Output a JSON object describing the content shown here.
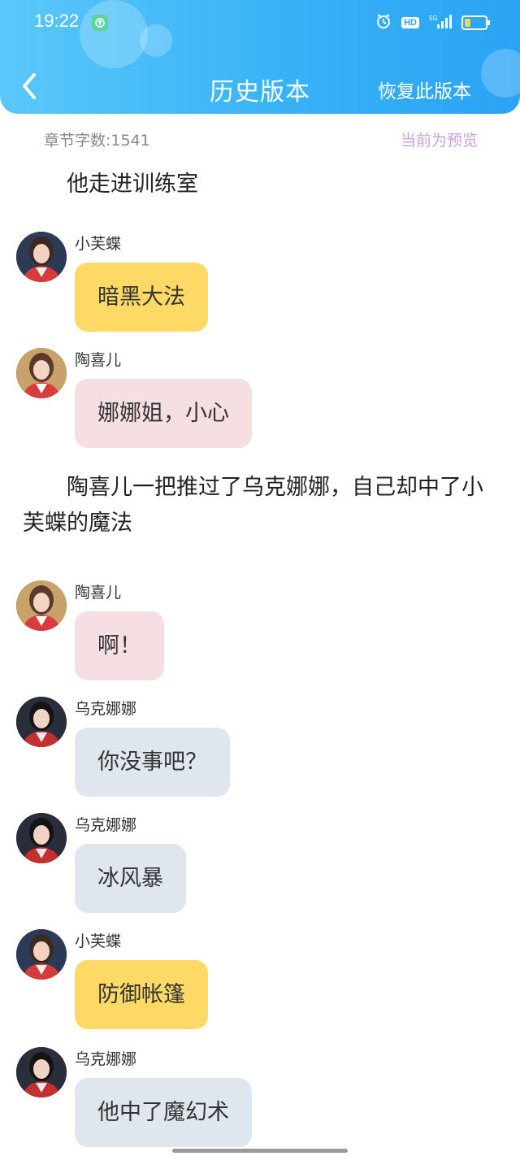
{
  "status_bar": {
    "time": "19:22",
    "hd_label": "HD",
    "network_label": "5G",
    "battery_level": 0.3
  },
  "header": {
    "title": "历史版本",
    "restore_label": "恢复此版本",
    "back_icon": "chevron-left-icon"
  },
  "info_bar": {
    "word_count": "章节字数:1541",
    "preview_status": "当前为预览"
  },
  "colors": {
    "header_start": "#5ac8fa",
    "header_end": "#2aa3f4",
    "bubble_xiaofudie": "#ffd966",
    "bubble_taoxier": "#f5dfe2",
    "bubble_wukenana": "#dfe6ee",
    "preview_status": "#c9a0d8"
  },
  "content": [
    {
      "type": "narration",
      "text": "　　他走进训练室"
    },
    {
      "type": "message",
      "speaker": "小芙蝶",
      "text": "暗黑大法",
      "style": "yellow"
    },
    {
      "type": "message",
      "speaker": "陶喜儿",
      "text": "娜娜姐，小心",
      "style": "pink"
    },
    {
      "type": "narration",
      "text": "　　陶喜儿一把推过了乌克娜娜，自己却中了小芙蝶的魔法"
    },
    {
      "type": "message",
      "speaker": "陶喜儿",
      "text": "啊！",
      "style": "pink"
    },
    {
      "type": "message",
      "speaker": "乌克娜娜",
      "text": "你没事吧？",
      "style": "gray"
    },
    {
      "type": "message",
      "speaker": "乌克娜娜",
      "text": "冰风暴",
      "style": "gray"
    },
    {
      "type": "message",
      "speaker": "小芙蝶",
      "text": "防御帐篷",
      "style": "yellow"
    },
    {
      "type": "message",
      "speaker": "乌克娜娜",
      "text": "他中了魔幻术",
      "style": "gray"
    }
  ]
}
